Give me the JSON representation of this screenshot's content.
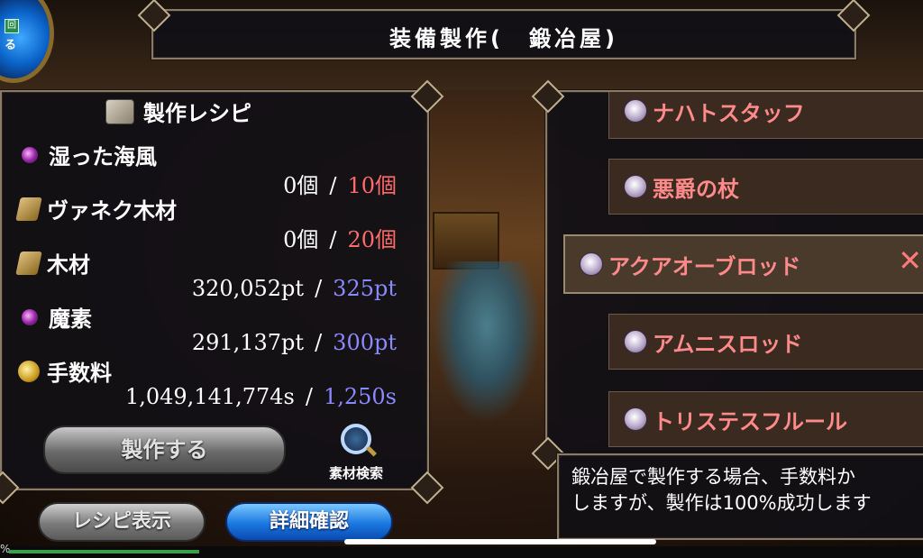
{
  "title": "装備製作(　鍛冶屋)",
  "orb": {
    "badge": "回",
    "label": "る"
  },
  "recipe_panel": {
    "header": "製作レシピ",
    "materials": [
      {
        "name": "湿った海風",
        "icon": "gem-icon",
        "owned": "0個",
        "required": "10個",
        "required_color": "#ff6a6a"
      },
      {
        "name": "ヴァネク木材",
        "icon": "wood-icon",
        "owned": "0個",
        "required": "20個",
        "required_color": "#ff6a6a"
      },
      {
        "name": "木材",
        "icon": "wood-icon",
        "owned": "320,052pt",
        "required": "325pt",
        "required_color": "#8a8aff"
      },
      {
        "name": "魔素",
        "icon": "gem-icon",
        "owned": "291,137pt",
        "required": "300pt",
        "required_color": "#8a8aff"
      },
      {
        "name": "手数料",
        "icon": "coin-icon",
        "owned": "1,049,141,774s",
        "required": "1,250s",
        "required_color": "#8a8aff"
      }
    ],
    "separator": "/",
    "craft_button": "製作する",
    "search_label": "素材検索"
  },
  "bottom_buttons": {
    "recipe": "レシピ表示",
    "detail": "詳細確認"
  },
  "item_list": [
    {
      "name": "ナハトスタッフ",
      "selected": false
    },
    {
      "name": "悪爵の杖",
      "selected": false
    },
    {
      "name": "アクアオーブロッド",
      "selected": true
    },
    {
      "name": "アムニスロッド",
      "selected": false
    },
    {
      "name": "トリステスフルール",
      "selected": false
    }
  ],
  "close_glyph": "✕",
  "info": {
    "line1": "鍛冶屋で製作する場合、手数料か",
    "line2": "しますが、製作は100%成功します"
  },
  "progress": {
    "label": "%",
    "value_fraction": 0.21
  }
}
